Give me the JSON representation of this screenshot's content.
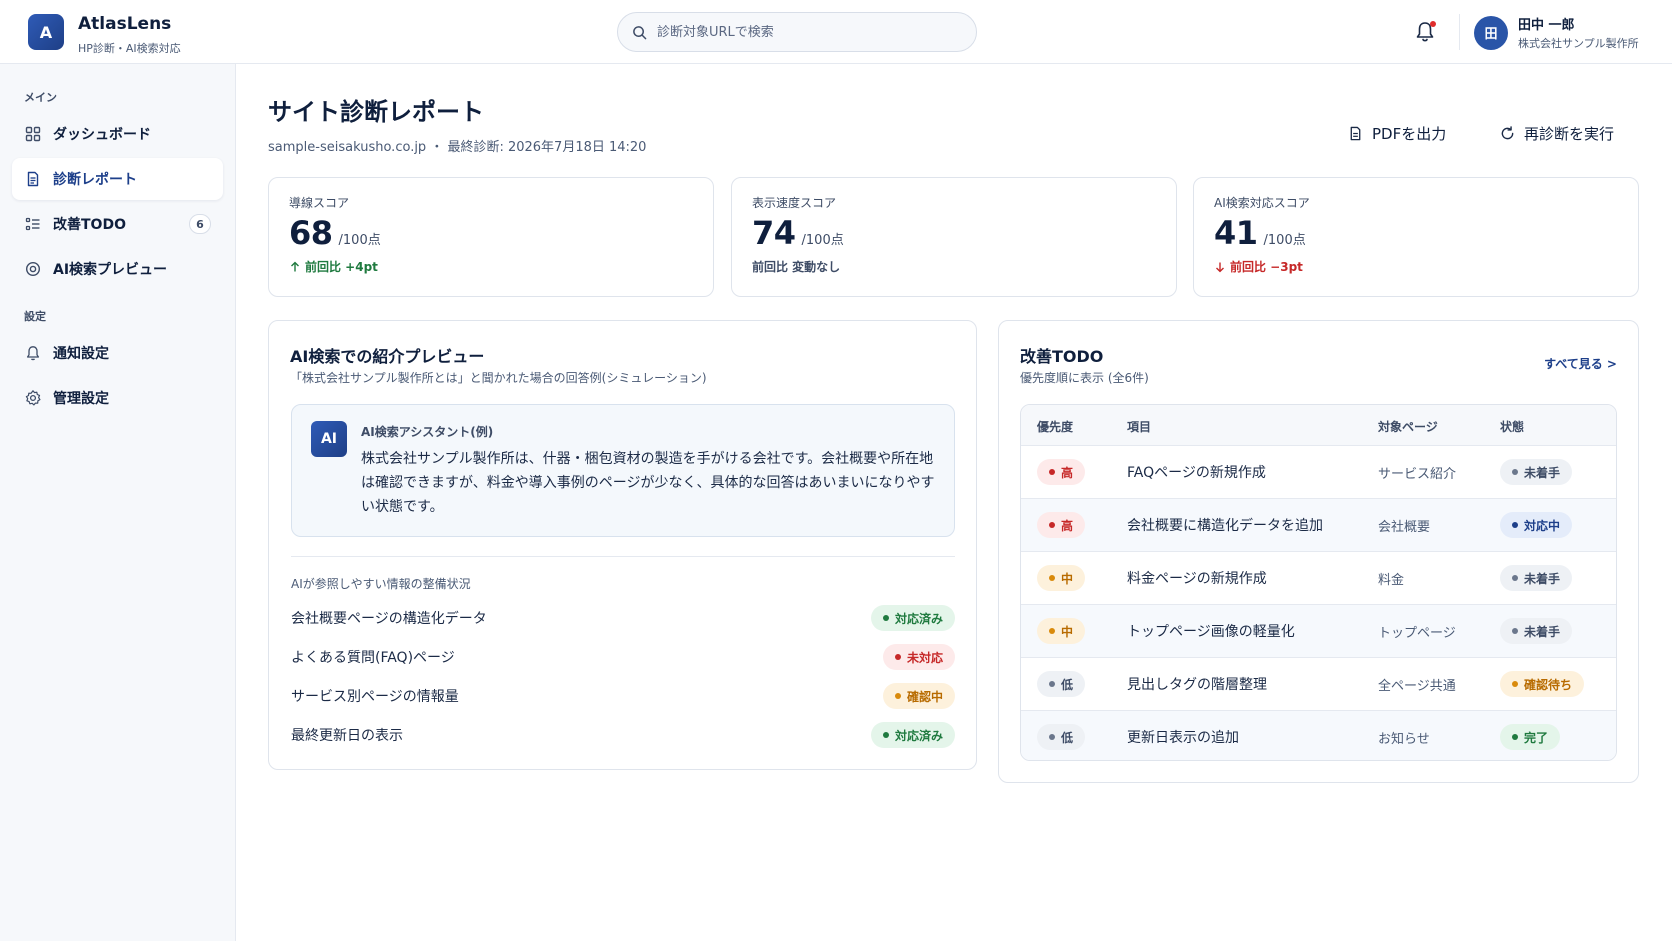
{
  "brand": {
    "logo_letter": "A",
    "name": "AtlasLens",
    "subtitle": "HP診断・AI検索対応"
  },
  "search": {
    "placeholder": "診断対象URLで検索"
  },
  "user": {
    "initial": "田",
    "name": "田中 一郎",
    "org": "株式会社サンプル製作所"
  },
  "sidebar": {
    "section_main": "メイン",
    "section_settings": "設定",
    "items": [
      {
        "label": "ダッシュボード",
        "icon": "grid-icon"
      },
      {
        "label": "診断レポート",
        "icon": "document-icon",
        "active": true
      },
      {
        "label": "改善TODO",
        "icon": "list-icon",
        "badge": "6"
      },
      {
        "label": "AI検索プレビュー",
        "icon": "target-icon"
      },
      {
        "label": "通知設定",
        "icon": "bell-icon"
      },
      {
        "label": "管理設定",
        "icon": "gear-icon"
      }
    ]
  },
  "page": {
    "title": "サイト診断レポート",
    "meta": "sample-seisakusho.co.jp ・ 最終診断: 2026年7月18日 14:20",
    "pdf_button": "PDFを出力",
    "rediagnose_button": "再診断を実行"
  },
  "scores": [
    {
      "label": "導線スコア",
      "value": "68",
      "unit": "/100点",
      "diff": "前回比 +4pt",
      "trend": "up"
    },
    {
      "label": "表示速度スコア",
      "value": "74",
      "unit": "/100点",
      "diff": "前回比 変動なし",
      "trend": "flat"
    },
    {
      "label": "AI検索対応スコア",
      "value": "41",
      "unit": "/100点",
      "diff": "前回比 −3pt",
      "trend": "down"
    }
  ],
  "ai_preview": {
    "title": "AI検索での紹介プレビュー",
    "subtitle": "「株式会社サンプル製作所とは」と聞かれた場合の回答例(シミュレーション)",
    "assistant_icon": "AI",
    "assistant_name": "AI検索アシスタント(例)",
    "answer": "株式会社サンプル製作所は、什器・梱包資材の製造を手がける会社です。会社概要や所在地は確認できますが、料金や導入事例のページが少なく、具体的な回答はあいまいになりやすい状態です。",
    "checklist_title": "AIが参照しやすい情報の整備状況",
    "checklist": [
      {
        "label": "会社概要ページの構造化データ",
        "status": "対応済み",
        "color": "green"
      },
      {
        "label": "よくある質問(FAQ)ページ",
        "status": "未対応",
        "color": "red"
      },
      {
        "label": "サービス別ページの情報量",
        "status": "確認中",
        "color": "amber"
      },
      {
        "label": "最終更新日の表示",
        "status": "対応済み",
        "color": "green"
      }
    ]
  },
  "todo": {
    "title": "改善TODO",
    "subtitle": "優先度順に表示 (全6件)",
    "see_all": "すべて見る >",
    "columns": [
      "優先度",
      "項目",
      "対象ページ",
      "状態"
    ],
    "rows": [
      {
        "priority": "高",
        "pcolor": "red",
        "item": "FAQページの新規作成",
        "page": "サービス紹介",
        "status": "未着手",
        "scolor": "gray"
      },
      {
        "priority": "高",
        "pcolor": "red",
        "item": "会社概要に構造化データを追加",
        "page": "会社概要",
        "status": "対応中",
        "scolor": "blue"
      },
      {
        "priority": "中",
        "pcolor": "amber",
        "item": "料金ページの新規作成",
        "page": "料金",
        "status": "未着手",
        "scolor": "gray"
      },
      {
        "priority": "中",
        "pcolor": "amber",
        "item": "トップページ画像の軽量化",
        "page": "トップページ",
        "status": "未着手",
        "scolor": "gray"
      },
      {
        "priority": "低",
        "pcolor": "gray",
        "item": "見出しタグの階層整理",
        "page": "全ページ共通",
        "status": "確認待ち",
        "scolor": "amber"
      },
      {
        "priority": "低",
        "pcolor": "gray",
        "item": "更新日表示の追加",
        "page": "お知らせ",
        "status": "完了",
        "scolor": "green"
      }
    ]
  }
}
